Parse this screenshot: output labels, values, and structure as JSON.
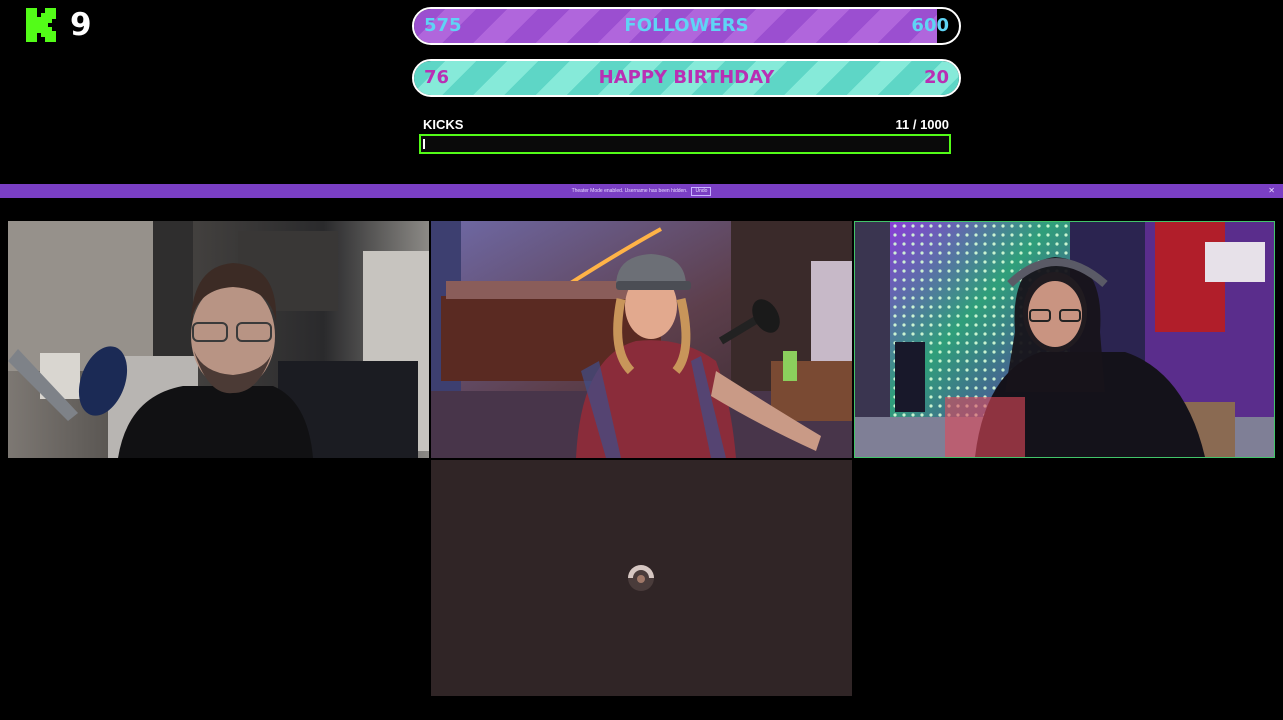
{
  "kick": {
    "icon": "kick-logo-icon",
    "brand_color": "#53fc18",
    "count": "9"
  },
  "goals": [
    {
      "left_value": "575",
      "title": "FOLLOWERS",
      "right_value": "600",
      "progress": 0.96,
      "color": "#9b4fd0",
      "text_color": "#5fd4f5"
    },
    {
      "left_value": "76",
      "title": "HAPPY BIRTHDAY",
      "right_value": "20",
      "progress": 1.0,
      "color": "#5ed6c6",
      "text_color": "#b92fb4"
    }
  ],
  "kicks_bar": {
    "label": "KICKS",
    "count": "11   / 1000",
    "progress": 0.011,
    "border_color": "#53fc18"
  },
  "banner": {
    "text": "Theater Mode enabled. Username has been hidden.",
    "button_label": "Undo",
    "close_icon": "close-icon",
    "color": "#7a3fc4"
  },
  "tiles": [
    {
      "name": "camera-feed-1"
    },
    {
      "name": "camera-feed-2"
    },
    {
      "name": "camera-feed-3",
      "active_border": "#42c46a"
    },
    {
      "name": "camera-feed-4-loading",
      "icon": "loading-spinner-icon"
    }
  ]
}
